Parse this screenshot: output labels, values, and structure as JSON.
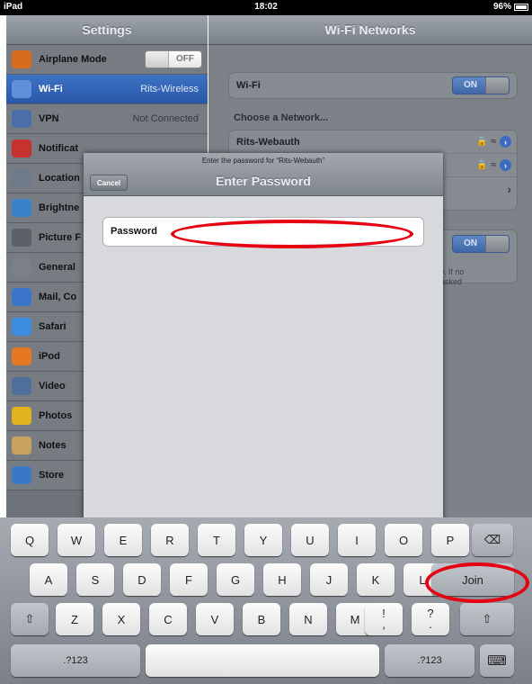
{
  "status_bar": {
    "device": "iPad",
    "time": "18:02",
    "battery": "96%"
  },
  "left_nav": {
    "title": "Settings",
    "items": [
      {
        "label": "Airplane Mode",
        "value": "OFF",
        "icon": "airplane-icon",
        "color": "#d96b1d"
      },
      {
        "label": "Wi-Fi",
        "value": "Rits-Wireless",
        "icon": "wifi-icon",
        "color": "#5e8fd8"
      },
      {
        "label": "VPN",
        "value": "Not Connected",
        "icon": "vpn-icon",
        "color": "#496ea8"
      },
      {
        "label": "Notificat",
        "value": "",
        "icon": "notifications-icon",
        "color": "#c9312e"
      },
      {
        "label": "Location",
        "value": "",
        "icon": "location-icon",
        "color": "#6c7a8c"
      },
      {
        "label": "Brightne",
        "value": "",
        "icon": "brightness-icon",
        "color": "#3b83c9"
      },
      {
        "label": "Picture F",
        "value": "",
        "icon": "picture-frame-icon",
        "color": "#5b5f66"
      },
      {
        "label": "General",
        "value": "",
        "icon": "general-gear-icon",
        "color": "#7b8088"
      },
      {
        "label": "Mail, Co",
        "value": "",
        "icon": "mail-icon",
        "color": "#3c74c9"
      },
      {
        "label": "Safari",
        "value": "",
        "icon": "safari-icon",
        "color": "#3a8de0"
      },
      {
        "label": "iPod",
        "value": "",
        "icon": "ipod-icon",
        "color": "#e67822"
      },
      {
        "label": "Video",
        "value": "",
        "icon": "video-icon",
        "color": "#4d6f9a"
      },
      {
        "label": "Photos",
        "value": "",
        "icon": "photos-icon",
        "color": "#e2b31f"
      },
      {
        "label": "Notes",
        "value": "",
        "icon": "notes-icon",
        "color": "#c7a25d"
      },
      {
        "label": "Store",
        "value": "",
        "icon": "store-icon",
        "color": "#3a77c5"
      }
    ]
  },
  "right_panel": {
    "title": "Wi-Fi Networks",
    "wifi_label": "Wi-Fi",
    "wifi_toggle": "ON",
    "choose_header": "Choose a Network...",
    "networks": [
      "Rits-Webauth"
    ],
    "ask_toggle": "ON",
    "ask_text_1": "y. If no",
    "ask_text_2": "asked"
  },
  "modal": {
    "prompt": "Enter the password for “Rits-Webauth”",
    "title": "Enter Password",
    "cancel_label": "Cancel",
    "password_label": "Password",
    "password_value": ""
  },
  "keyboard": {
    "row1": [
      "Q",
      "W",
      "E",
      "R",
      "T",
      "Y",
      "U",
      "I",
      "O",
      "P"
    ],
    "row2": [
      "A",
      "S",
      "D",
      "F",
      "G",
      "H",
      "J",
      "K",
      "L"
    ],
    "row3": [
      "Z",
      "X",
      "C",
      "V",
      "B",
      "N",
      "M"
    ],
    "join_label": "Join",
    "numbers_label": ".?123",
    "punct1_top": "!",
    "punct1_bottom": ",",
    "punct2_top": "?",
    "punct2_bottom": "."
  },
  "colors": {
    "annotation": "#e50012",
    "selected": "#2f5fae"
  }
}
